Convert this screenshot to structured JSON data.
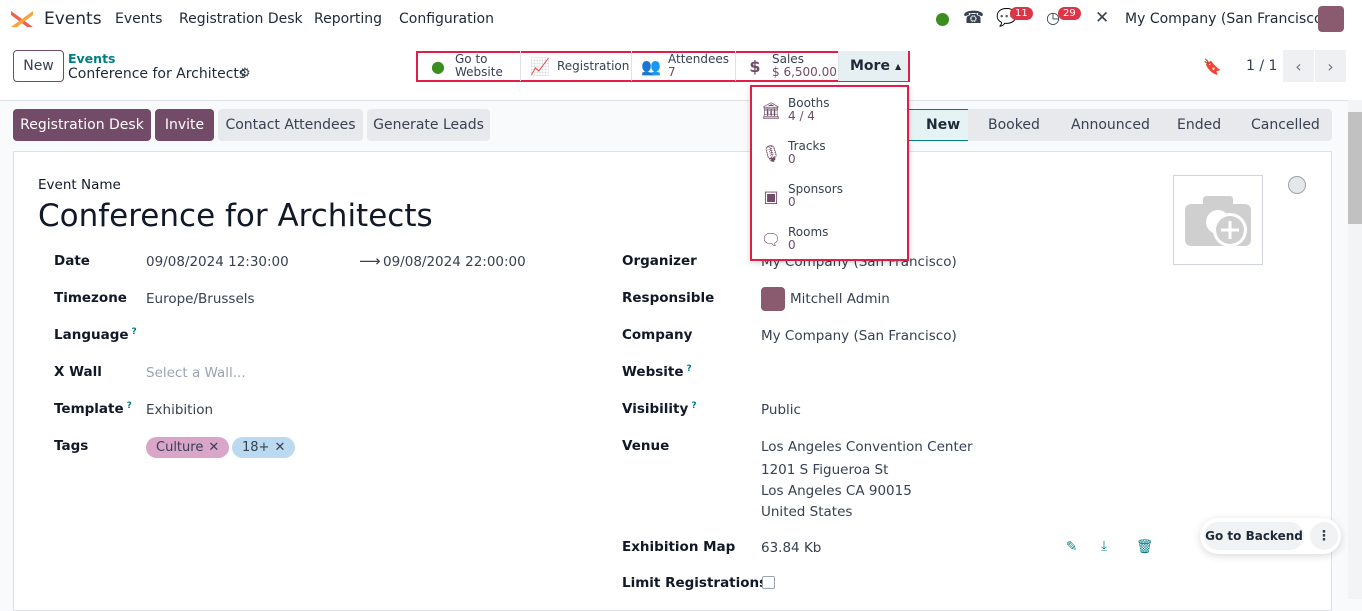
{
  "navbar": {
    "app": "Events",
    "menu": [
      "Events",
      "Registration Desk",
      "Reporting",
      "Configuration"
    ],
    "messages_count": "11",
    "activities_count": "29",
    "company": "My Company (San Francisco)"
  },
  "control": {
    "new_label": "New",
    "breadcrumb_parent": "Events",
    "breadcrumb_current": "Conference for Architects",
    "pager": "1 / 1"
  },
  "smart_buttons": [
    {
      "label": "Go to",
      "label2": "Website",
      "icon": "globe-icon"
    },
    {
      "label": "Registration",
      "icon": "chart-line-icon"
    },
    {
      "label": "Attendees",
      "value": "7",
      "icon": "users-icon"
    },
    {
      "label": "Sales",
      "value": "$ 6,500.00",
      "icon": "dollar-icon"
    },
    {
      "label": "More"
    }
  ],
  "more_menu": [
    {
      "label": "Booths",
      "value": "4 / 4",
      "icon": "bank-icon"
    },
    {
      "label": "Tracks",
      "value": "0",
      "icon": "microphone-icon"
    },
    {
      "label": "Sponsors",
      "value": "0",
      "icon": "sponsor-icon"
    },
    {
      "label": "Rooms",
      "value": "0",
      "icon": "comments-icon"
    }
  ],
  "actions": [
    "Registration Desk",
    "Invite",
    "Contact Attendees",
    "Generate Leads"
  ],
  "stages": [
    "New",
    "Booked",
    "Announced",
    "Ended",
    "Cancelled"
  ],
  "active_stage": "New",
  "form": {
    "event_name_label": "Event Name",
    "event_name": "Conference for Architects",
    "date_label": "Date",
    "date_start": "09/08/2024 12:30:00",
    "date_end": "09/08/2024 22:00:00",
    "timezone_label": "Timezone",
    "timezone": "Europe/Brussels",
    "language_label": "Language",
    "xwall_label": "X Wall",
    "xwall_placeholder": "Select a Wall...",
    "template_label": "Template",
    "template": "Exhibition",
    "tags_label": "Tags",
    "tags": [
      "Culture",
      "18+"
    ],
    "organizer_label": "Organizer",
    "organizer": "My Company (San Francisco)",
    "responsible_label": "Responsible",
    "responsible": "Mitchell Admin",
    "company_label": "Company",
    "company": "My Company (San Francisco)",
    "website_label": "Website",
    "visibility_label": "Visibility",
    "visibility": "Public",
    "venue_label": "Venue",
    "venue": [
      "Los Angeles Convention Center",
      "1201 S Figueroa St",
      "Los Angeles CA 90015",
      "United States"
    ],
    "map_label": "Exhibition Map",
    "map_size": "63.84 Kb",
    "limit_label": "Limit Registrations",
    "limit_checked": false,
    "help": "?"
  },
  "floating": {
    "backend_label": "Go to Backend"
  },
  "colors": {
    "primary": "#714b67",
    "accent": "#017e84",
    "highlight": "#e11d48"
  }
}
